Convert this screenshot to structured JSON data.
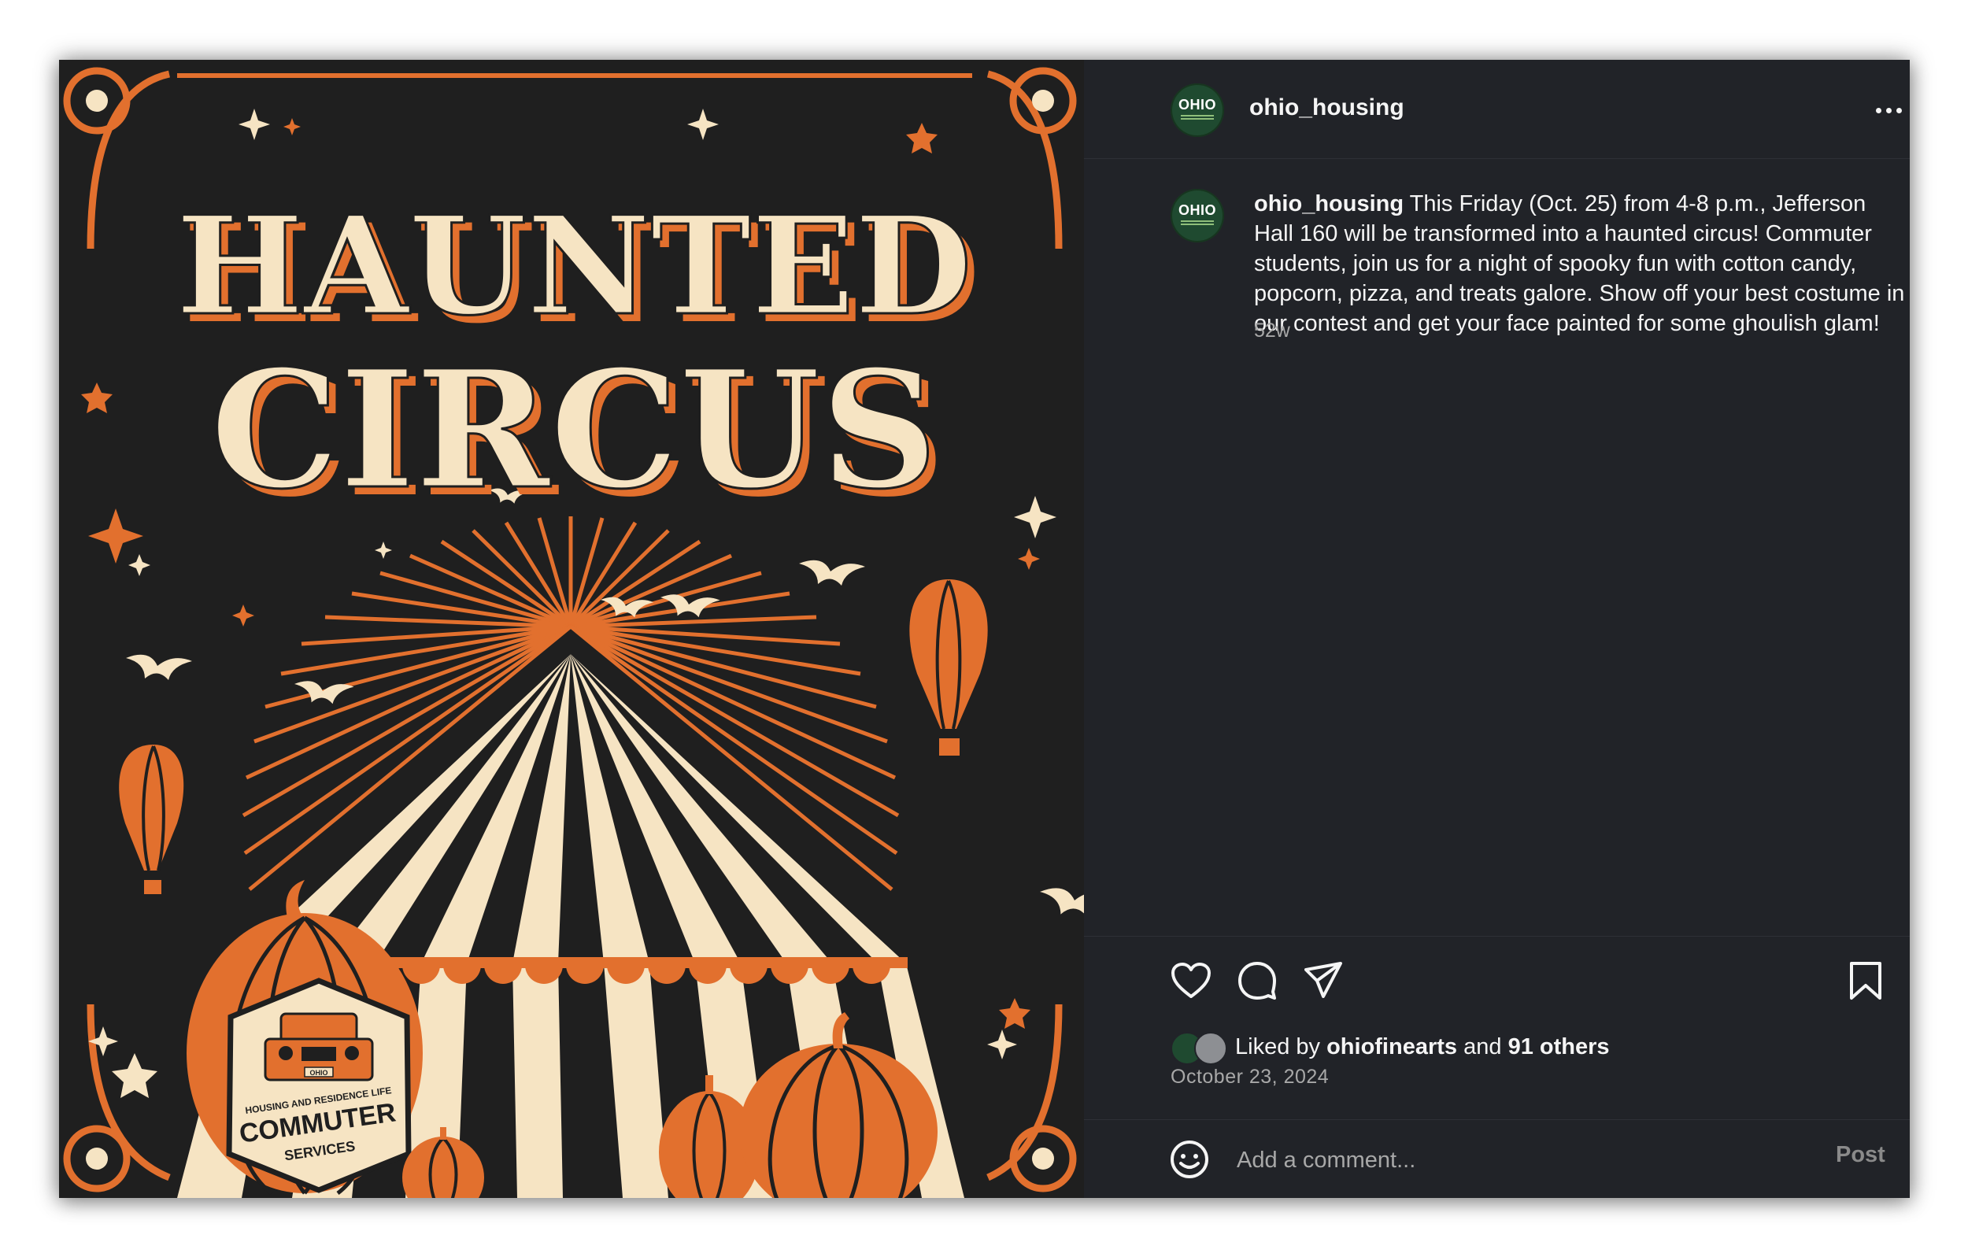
{
  "post": {
    "username": "ohio_housing",
    "avatar_text": "OHIO",
    "caption": {
      "username": "ohio_housing",
      "text": "This Friday (Oct. 25) from 4-8 p.m., Jefferson Hall 160 will be transformed into a haunted circus! Commuter students, join us for a night of spooky fun with cotton candy, popcorn, pizza, and treats galore. Show off your best costume in our contest and get your face painted for some ghoulish glam!",
      "time": "52w"
    },
    "likes": {
      "prefix": "Liked by",
      "user": "ohiofinearts",
      "middle": "and",
      "others": "91 others"
    },
    "date": "October 23, 2024",
    "comment_placeholder": "Add a comment...",
    "post_label": "Post"
  },
  "poster": {
    "line1": "HAUNTED",
    "line2": "CIRCUS",
    "badge_line1": "HOUSING AND RESIDENCE LIFE",
    "badge_line2": "COMMUTER",
    "badge_line3": "SERVICES",
    "plate": "OHIO"
  },
  "colors": {
    "background": "#212328",
    "text": "#f5f5f5",
    "muted": "#a8a8a8",
    "poster_orange": "#e2702e",
    "poster_cream": "#f6e4c3",
    "poster_dark": "#1f1f1f"
  },
  "icons": [
    "more-icon",
    "heart-icon",
    "comment-icon",
    "share-icon",
    "bookmark-icon",
    "emoji-icon"
  ]
}
